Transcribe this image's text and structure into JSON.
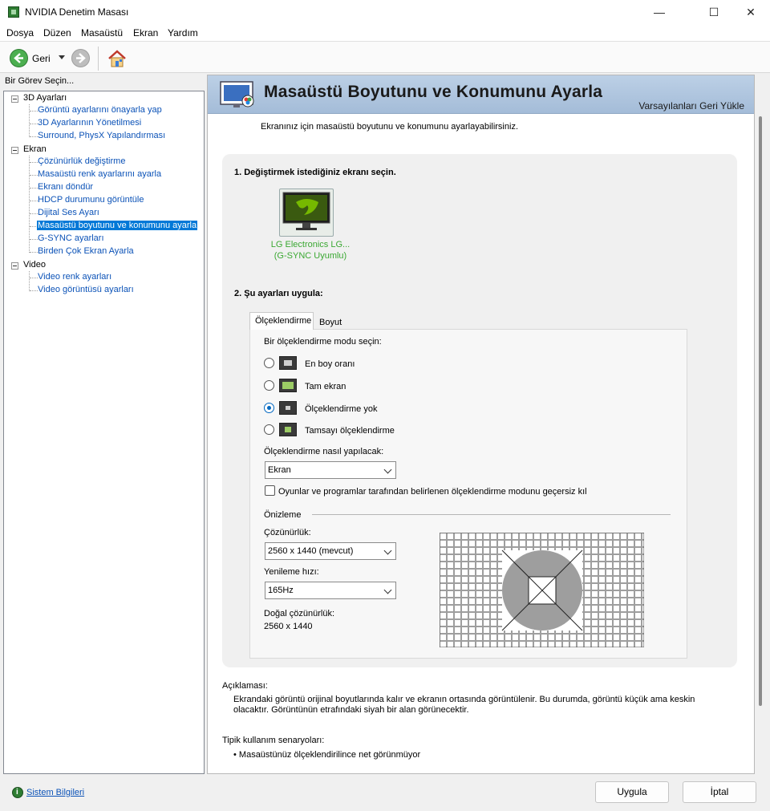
{
  "window": {
    "title": "NVIDIA Denetim Masası",
    "minimize": "—",
    "maximize": "☐",
    "close": "✕"
  },
  "menu": [
    "Dosya",
    "Düzen",
    "Masaüstü",
    "Ekran",
    "Yardım"
  ],
  "toolbar": {
    "back_label": "Geri"
  },
  "left": {
    "header": "Bir Görev Seçin...",
    "groups": [
      {
        "label": "3D Ayarları",
        "items": [
          "Görüntü ayarlarını önayarla yap",
          "3D Ayarlarının Yönetilmesi",
          "Surround, PhysX Yapılandırması"
        ]
      },
      {
        "label": "Ekran",
        "items": [
          "Çözünürlük değiştirme",
          "Masaüstü renk ayarlarını ayarla",
          "Ekranı döndür",
          "HDCP durumunu görüntüle",
          "Dijital Ses Ayarı",
          "Masaüstü boyutunu ve konumunu ayarla",
          "G-SYNC ayarları",
          "Birden Çok Ekran Ayarla"
        ]
      },
      {
        "label": "Video",
        "items": [
          "Video renk ayarları",
          "Video görüntüsü ayarları"
        ]
      }
    ],
    "selected": "Masaüstü boyutunu ve konumunu ayarla"
  },
  "page": {
    "title": "Masaüstü Boyutunu ve Konumunu Ayarla",
    "restore_defaults": "Varsayılanları Geri Yükle",
    "intro": "Ekranınız için masaüstü boyutunu ve konumunu ayarlayabilirsiniz.",
    "step1": "1. Değiştirmek istediğiniz ekranı seçin.",
    "monitor_name": "LG Electronics LG...",
    "monitor_sub": "(G-SYNC Uyumlu)",
    "step2": "2. Şu ayarları uygula:",
    "tabs": [
      "Ölçeklendirme",
      "Boyut"
    ],
    "scaling_mode_label": "Bir ölçeklendirme modu seçin:",
    "scaling_modes": [
      "En boy oranı",
      "Tam ekran",
      "Ölçeklendirme yok",
      "Tamsayı ölçeklendirme"
    ],
    "selected_mode": "Ölçeklendirme yok",
    "perform_label": "Ölçeklendirme nasıl yapılacak:",
    "perform_value": "Ekran",
    "override_checkbox": "Oyunlar ve programlar tarafından belirlenen ölçeklendirme modunu geçersiz kıl",
    "override_checked": false,
    "preview_label": "Önizleme",
    "resolution_label": "Çözünürlük:",
    "resolution_value": "2560 x 1440 (mevcut)",
    "refresh_label": "Yenileme hızı:",
    "refresh_value": "165Hz",
    "native_label": "Doğal çözünürlük:",
    "native_value": "2560 x 1440",
    "description_label": "Açıklaması:",
    "description_line1": "Ekrandaki görüntü orijinal boyutlarında kalır ve ekranın ortasında görüntülenir. Bu durumda, görüntü küçük ama keskin",
    "description_line2": "olacaktır. Görüntünün etrafındaki siyah bir alan görünecektir.",
    "usage_label": "Tipik kullanım senaryoları:",
    "usage_item": "• Masaüstünüz ölçeklendirilince net görünmüyor"
  },
  "footer": {
    "system_info": "Sistem Bilgileri",
    "apply": "Uygula",
    "cancel": "İptal"
  },
  "colors": {
    "accent": "#0078d7",
    "nvidia_green": "#76b900",
    "link": "#0b52b7"
  }
}
